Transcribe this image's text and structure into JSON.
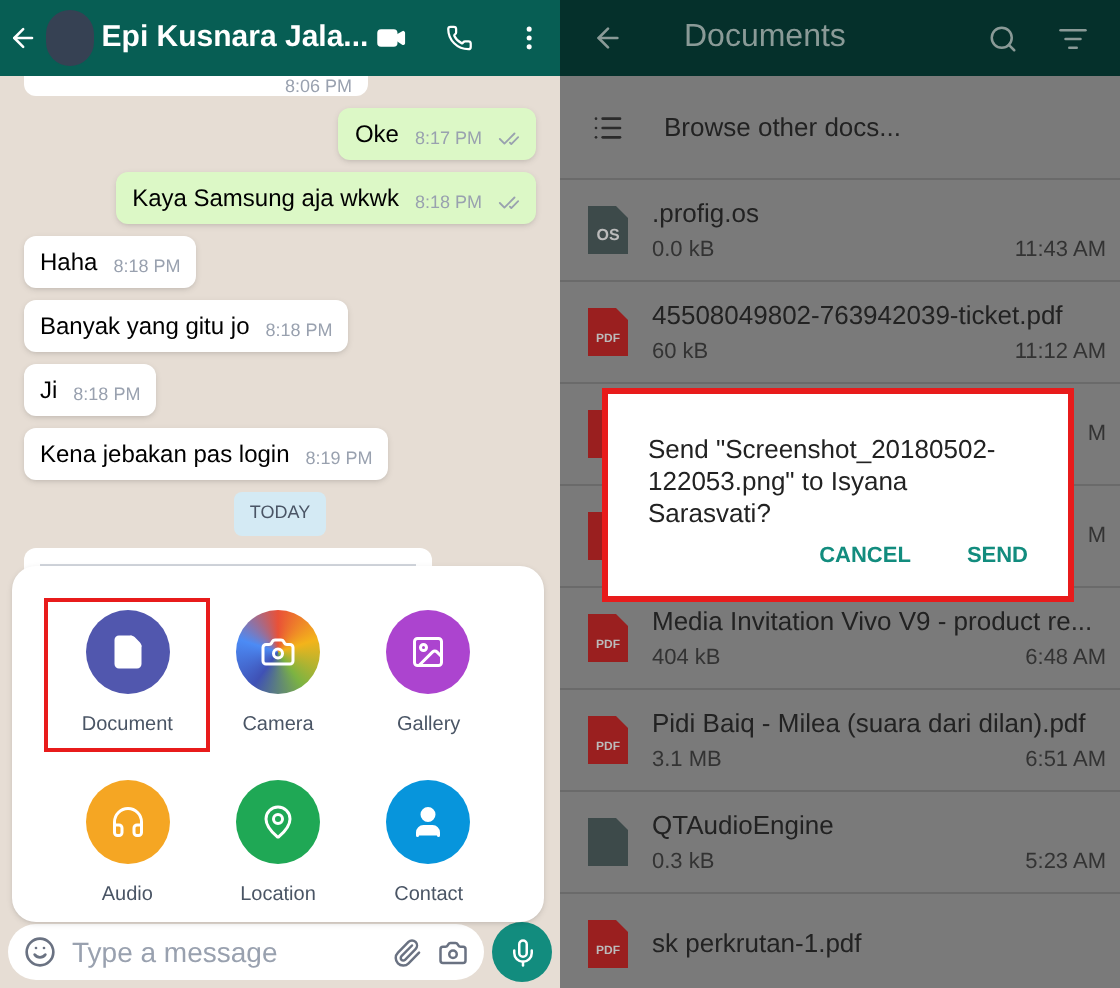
{
  "chat": {
    "contact": "Epi Kusnara Jala...",
    "messages": [
      {
        "kind": "cut",
        "time": "8:06 PM"
      },
      {
        "kind": "out",
        "text": "Oke",
        "time": "8:17 PM"
      },
      {
        "kind": "out",
        "text": "Kaya Samsung aja wkwk",
        "time": "8:18 PM"
      },
      {
        "kind": "in",
        "text": "Haha",
        "time": "8:18 PM"
      },
      {
        "kind": "in",
        "text": "Banyak yang gitu jo",
        "time": "8:18 PM"
      },
      {
        "kind": "in",
        "text": "Ji",
        "time": "8:18 PM"
      },
      {
        "kind": "in",
        "text": "Kena jebakan pas login",
        "time": "8:19 PM"
      },
      {
        "kind": "date",
        "text": "TODAY"
      },
      {
        "kind": "image"
      }
    ],
    "attach": [
      {
        "kind": "document",
        "label": "Document",
        "highlighted": true
      },
      {
        "kind": "camera",
        "label": "Camera",
        "highlighted": false
      },
      {
        "kind": "gallery",
        "label": "Gallery",
        "highlighted": false
      },
      {
        "kind": "audio",
        "label": "Audio",
        "highlighted": false
      },
      {
        "kind": "location",
        "label": "Location",
        "highlighted": false
      },
      {
        "kind": "contact",
        "label": "Contact",
        "highlighted": false
      }
    ],
    "input": {
      "placeholder": "Type a message"
    }
  },
  "documents": {
    "title": "Documents",
    "browse": "Browse other docs...",
    "files": [
      {
        "kind": "os",
        "icon_label": "OS",
        "name": ".profig.os",
        "size": "0.0 kB",
        "time": "11:43 AM"
      },
      {
        "kind": "pdf",
        "icon_label": "PDF",
        "name": "45508049802-763942039-ticket.pdf",
        "size": "60 kB",
        "time": "11:12 AM"
      },
      {
        "kind": "covered",
        "time": "M"
      },
      {
        "kind": "covered",
        "time": "M"
      },
      {
        "kind": "pdf",
        "icon_label": "PDF",
        "name": "Media Invitation Vivo V9 - product re...",
        "size": "404 kB",
        "time": "6:48 AM"
      },
      {
        "kind": "pdf",
        "icon_label": "PDF",
        "name": "Pidi Baiq - Milea (suara dari dilan).pdf",
        "size": "3.1 MB",
        "time": "6:51 AM"
      },
      {
        "kind": "file",
        "name": "QTAudioEngine",
        "size": "0.3 kB",
        "time": "5:23 AM"
      },
      {
        "kind": "pdf",
        "icon_label": "PDF",
        "name": "sk perkrutan-1.pdf"
      }
    ],
    "dialog": {
      "message": "Send \"Screenshot_20180502-122053.png\" to Isyana Sarasvati?",
      "highlighted": true,
      "buttons": [
        "CANCEL",
        "SEND"
      ]
    }
  }
}
